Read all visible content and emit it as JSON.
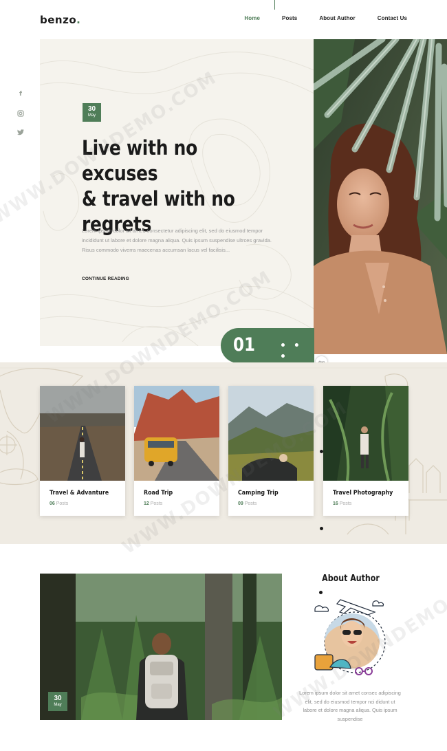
{
  "header": {
    "logo": "benzo",
    "logo_dot": ".",
    "nav": [
      "Home",
      "Posts",
      "About Author",
      "Contact Us"
    ],
    "active_nav": "Home"
  },
  "social": {
    "facebook_glyph": "f",
    "instagram_glyph": "◘",
    "twitter_glyph": "🐦"
  },
  "hero": {
    "date_day": "30",
    "date_month": "May",
    "title": "Live with no excuses\n& travel with no\nregrets",
    "text": "Lorem ipsum dolor sit amet, consectetur adipiscing elit, sed do eiusmod tempor incididunt ut labore et dolore magna aliqua. Quis ipsum suspendise ultrces gravida. Risus commodo viverra maecenas accumsan lacus vel facilisis...",
    "link": "CONTINUE READING",
    "slide_number": "01",
    "slide_dots": "• • •",
    "drag_label": "drag"
  },
  "categories": [
    {
      "name": "Travel & Advanture",
      "count": "06",
      "unit": "Posts"
    },
    {
      "name": "Road Trip",
      "count": "12",
      "unit": "Posts"
    },
    {
      "name": "Camping Trip",
      "count": "09",
      "unit": "Posts"
    },
    {
      "name": "Travel Photography",
      "count": "16",
      "unit": "Posts"
    }
  ],
  "feature": {
    "date_day": "30",
    "date_month": "May"
  },
  "about": {
    "title": "About Author",
    "text": "Lorem ipsum dolor sit amet consec adipiscing elit, sed do eiusmod tempor nci didunt ut labore et dolore magna aliqua. Quis ipsum suspendise"
  },
  "watermark": "WWW.DOWNDEMO.COM",
  "colors": {
    "accent": "#4f7d58",
    "hero_bg": "#f5f3ed",
    "category_bg": "#efebe3"
  }
}
